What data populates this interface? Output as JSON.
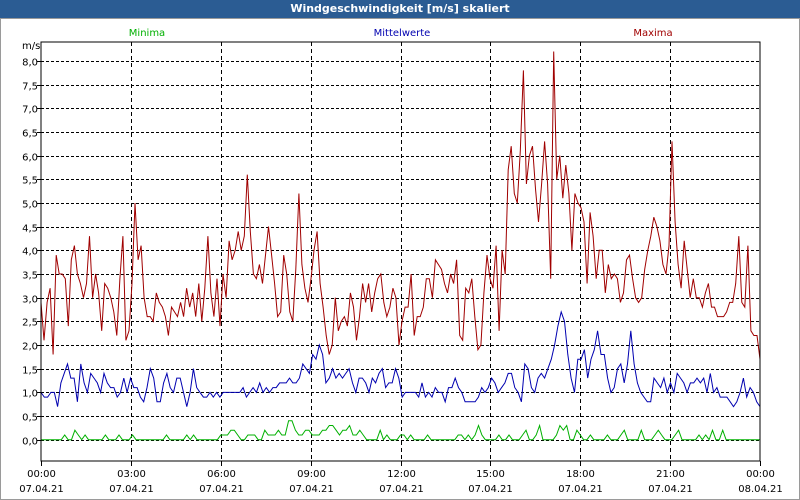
{
  "window": {
    "title": "Windgeschwindigkeit [m/s] skaliert"
  },
  "colors": {
    "min": "#00b000",
    "mean": "#0000b0",
    "max": "#a00000",
    "grid": "#000000",
    "titlebar": "#2b5c93"
  },
  "chart_data": {
    "type": "line",
    "title": "Windgeschwindigkeit [m/s] skaliert",
    "ylabel": "m/s",
    "ylim": [
      -0.45,
      8.4
    ],
    "yticks": [
      "0,0",
      "0,5",
      "1,0",
      "1,5",
      "2,0",
      "2,5",
      "3,0",
      "3,5",
      "4,0",
      "4,5",
      "5,0",
      "5,5",
      "6,0",
      "6,5",
      "7,0",
      "7,5",
      "8,0"
    ],
    "xlim_hours": [
      0,
      24
    ],
    "xticks": [
      {
        "time": "00:00",
        "date": "07.04.21"
      },
      {
        "time": "03:00",
        "date": "07.04.21"
      },
      {
        "time": "06:00",
        "date": "07.04.21"
      },
      {
        "time": "09:00",
        "date": "07.04.21"
      },
      {
        "time": "12:00",
        "date": "07.04.21"
      },
      {
        "time": "15:00",
        "date": "07.04.21"
      },
      {
        "time": "18:00",
        "date": "07.04.21"
      },
      {
        "time": "21:00",
        "date": "07.04.21"
      },
      {
        "time": "00:00",
        "date": "08.04.21"
      }
    ],
    "grid": true,
    "legend_position": "top",
    "series": [
      {
        "name": "Minima",
        "color": "#00b000",
        "values": [
          0,
          0,
          0,
          0,
          0,
          0,
          0,
          0.1,
          0,
          0,
          0.2,
          0.1,
          0,
          0.1,
          0,
          0,
          0,
          0,
          0,
          0.1,
          0,
          0,
          0,
          0.1,
          0,
          0,
          0,
          0.1,
          0,
          0,
          0,
          0,
          0,
          0,
          0,
          0,
          0,
          0.1,
          0,
          0,
          0,
          0,
          0,
          0.1,
          0,
          0.1,
          0,
          0,
          0,
          0,
          0,
          0,
          0,
          0.1,
          0.1,
          0.1,
          0.2,
          0.2,
          0.1,
          0,
          0,
          0.1,
          0.1,
          0.1,
          0,
          0,
          0.2,
          0.1,
          0.1,
          0.1,
          0.2,
          0.1,
          0.1,
          0.4,
          0.4,
          0.2,
          0.1,
          0.1,
          0.2,
          0.2,
          0.1,
          0.1,
          0.1,
          0.2,
          0.2,
          0.3,
          0.3,
          0.2,
          0.1,
          0.2,
          0.2,
          0.3,
          0.1,
          0.1,
          0.2,
          0.1,
          0,
          0,
          0,
          0,
          0.2,
          0,
          0.1,
          0,
          0,
          0,
          0.1,
          0.1,
          0,
          0.1,
          0,
          0,
          0,
          0,
          0.1,
          0,
          0,
          0,
          0,
          0,
          0,
          0,
          0,
          0.1,
          0.1,
          0,
          0.1,
          0,
          0.1,
          0.3,
          0.1,
          0,
          0,
          0,
          0,
          0.1,
          0,
          0,
          0.1,
          0,
          0,
          0,
          0.1,
          0.2,
          0,
          0,
          0.1,
          0.3,
          0,
          0,
          0,
          0,
          0.1,
          0.3,
          0.2,
          0.3,
          0,
          0,
          0.2,
          0.1,
          0,
          0,
          0.1,
          0,
          0,
          0,
          0,
          0.1,
          0,
          0,
          0,
          0.1,
          0.2,
          0,
          0,
          0,
          0,
          0.2,
          0,
          0,
          0,
          0.1,
          0.2,
          0.1,
          0,
          0,
          0,
          0.1,
          0.2,
          0,
          0,
          0,
          0,
          0,
          0.1,
          0,
          0.1,
          0,
          0.2,
          0,
          0,
          0.2,
          0,
          0,
          0,
          0,
          0,
          0,
          0,
          0,
          0,
          0,
          0
        ]
      },
      {
        "name": "Mittelwerte",
        "color": "#0000b0",
        "values": [
          1.0,
          0.9,
          0.9,
          1.0,
          1.0,
          0.7,
          1.2,
          1.4,
          1.6,
          1.3,
          1.3,
          0.8,
          1.6,
          1.2,
          1.0,
          1.4,
          1.3,
          1.2,
          1.0,
          1.4,
          1.2,
          1.1,
          1.1,
          0.9,
          1.0,
          1.3,
          1.0,
          1.3,
          1.1,
          1.1,
          0.9,
          0.8,
          1.1,
          1.5,
          1.3,
          0.8,
          0.8,
          1.2,
          1.4,
          1.1,
          1.0,
          1.3,
          1.3,
          1.0,
          0.7,
          1.0,
          1.5,
          1.1,
          1.0,
          0.9,
          0.9,
          1.0,
          0.9,
          1.0,
          0.9,
          1.0,
          1.0,
          1.0,
          1.0,
          1.0,
          1.0,
          1.1,
          0.9,
          1.0,
          1.1,
          1.0,
          1.2,
          1.0,
          1.1,
          1.0,
          1.1,
          1.1,
          1.2,
          1.2,
          1.2,
          1.3,
          1.2,
          1.2,
          1.3,
          1.6,
          1.5,
          1.4,
          1.8,
          1.7,
          2.0,
          1.8,
          1.2,
          1.3,
          1.5,
          1.3,
          1.4,
          1.3,
          1.4,
          1.5,
          1.2,
          1.0,
          1.3,
          1.3,
          1.2,
          1.0,
          1.3,
          1.2,
          1.4,
          1.5,
          1.1,
          1.2,
          1.2,
          1.5,
          1.3,
          0.9,
          1.0,
          1.0,
          1.0,
          1.0,
          0.9,
          1.2,
          0.9,
          1.0,
          0.9,
          1.1,
          1.0,
          1.0,
          0.8,
          1.1,
          1.1,
          1.3,
          1.1,
          1.0,
          0.8,
          0.8,
          0.8,
          0.8,
          0.9,
          1.1,
          1.0,
          1.1,
          1.3,
          1.2,
          1.0,
          1.1,
          1.2,
          1.4,
          1.4,
          1.1,
          1.0,
          0.8,
          1.6,
          1.5,
          1.1,
          1.0,
          1.3,
          1.4,
          1.3,
          1.5,
          1.7,
          2.0,
          2.4,
          2.7,
          2.5,
          1.8,
          1.3,
          1.0,
          1.7,
          1.7,
          1.9,
          1.3,
          1.7,
          1.9,
          2.3,
          1.8,
          1.8,
          1.3,
          1.0,
          1.1,
          1.5,
          1.6,
          1.2,
          1.6,
          2.3,
          1.6,
          1.2,
          1.0,
          0.9,
          0.8,
          0.8,
          1.3,
          1.2,
          1.1,
          1.3,
          1.0,
          1.2,
          1.0,
          1.4,
          1.3,
          1.2,
          1.0,
          1.2,
          1.2,
          1.3,
          1.2,
          1.3,
          1.0,
          1.4,
          1.0,
          1.1,
          0.9,
          0.9,
          0.9,
          0.8,
          0.7,
          0.8,
          1.0,
          1.3,
          0.9,
          1.1,
          1.0,
          0.8,
          0.7
        ]
      },
      {
        "name": "Maxima",
        "color": "#a00000",
        "values": [
          2.9,
          2.1,
          2.9,
          3.2,
          1.8,
          3.9,
          3.5,
          3.5,
          3.4,
          2.4,
          3.8,
          4.1,
          3.5,
          3.3,
          3.0,
          3.3,
          4.3,
          3.0,
          3.5,
          3.1,
          2.3,
          3.3,
          3.2,
          3.0,
          2.7,
          2.2,
          3.4,
          4.3,
          2.1,
          2.3,
          3.3,
          5.0,
          3.8,
          4.1,
          3.0,
          2.6,
          2.6,
          2.5,
          3.1,
          2.9,
          2.8,
          2.6,
          2.2,
          2.8,
          2.7,
          2.6,
          2.9,
          2.6,
          3.2,
          2.8,
          3.1,
          2.6,
          3.3,
          2.5,
          3.2,
          4.3,
          3.1,
          2.6,
          3.4,
          2.4,
          3.5,
          3.0,
          4.2,
          3.8,
          4.0,
          4.4,
          4.0,
          4.3,
          5.6,
          4.4,
          3.5,
          3.4,
          3.7,
          3.3,
          3.9,
          4.5,
          3.9,
          3.3,
          2.6,
          2.7,
          3.9,
          3.5,
          2.7,
          2.5,
          3.6,
          5.2,
          3.7,
          3.2,
          2.9,
          3.4,
          4.0,
          4.4,
          3.3,
          2.8,
          2.2,
          1.8,
          2.0,
          3.0,
          2.3,
          2.5,
          2.6,
          2.4,
          3.1,
          2.8,
          2.1,
          2.6,
          3.3,
          2.9,
          3.3,
          2.7,
          3.1,
          3.4,
          3.5,
          2.9,
          2.6,
          2.8,
          3.2,
          3.0,
          2.0,
          2.5,
          2.8,
          2.8,
          3.5,
          2.2,
          2.6,
          2.6,
          2.8,
          3.4,
          3.4,
          3.0,
          3.8,
          3.7,
          3.6,
          3.3,
          3.1,
          3.5,
          3.3,
          3.8,
          2.2,
          2.1,
          3.2,
          3.1,
          3.4,
          2.6,
          1.9,
          2.0,
          3.1,
          3.9,
          3.4,
          3.2,
          4.1,
          2.3,
          4.0,
          3.5,
          5.7,
          6.2,
          5.2,
          5.0,
          6.1,
          7.8,
          5.4,
          6.0,
          6.2,
          5.3,
          4.6,
          5.4,
          6.3,
          5.4,
          3.4,
          8.2,
          5.5,
          6.0,
          5.1,
          5.8,
          5.2,
          4.0,
          5.2,
          5.0,
          4.9,
          4.6,
          3.3,
          4.8,
          4.3,
          3.4,
          4.0,
          4.0,
          3.1,
          3.7,
          3.4,
          3.5,
          3.4,
          2.9,
          3.1,
          3.8,
          3.9,
          3.4,
          3.0,
          2.9,
          3.0,
          3.6,
          4.0,
          4.3,
          4.7,
          4.5,
          4.2,
          3.7,
          3.5,
          4.1,
          6.3,
          4.6,
          3.7,
          3.2,
          4.2,
          3.6,
          3.0,
          3.4,
          3.0,
          3.0,
          2.8,
          3.1,
          3.3,
          2.8,
          2.8,
          2.6,
          2.6,
          2.6,
          2.7,
          2.9,
          2.9,
          3.3,
          4.3,
          2.9,
          2.8,
          4.1,
          2.3,
          2.2,
          2.2,
          1.7
        ]
      }
    ]
  }
}
